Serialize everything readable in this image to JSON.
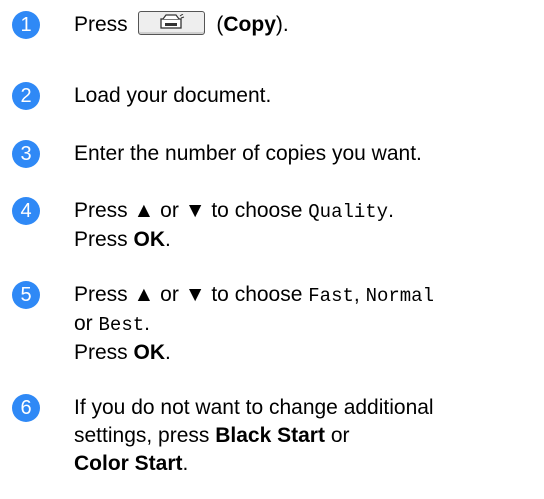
{
  "steps": [
    {
      "n": "1",
      "press": "Press",
      "open": "(",
      "bold": "Copy",
      "close": ")."
    },
    {
      "n": "2",
      "text": "Load your document."
    },
    {
      "n": "3",
      "text": "Enter the number of copies you want."
    },
    {
      "n": "4",
      "press": "Press",
      "up": "▲",
      "or": "or",
      "down": "▼",
      "to_choose": "to choose",
      "code": "Quality",
      "period": ".",
      "press2": "Press",
      "ok": "OK",
      "period2": "."
    },
    {
      "n": "5",
      "press": "Press",
      "up": "▲",
      "or": "or",
      "down": "▼",
      "to_choose": "to choose",
      "code1": "Fast",
      "comma": ",",
      "code2": "Normal",
      "or2": "or",
      "code3": "Best",
      "period": ".",
      "press2": "Press",
      "ok": "OK",
      "period2": "."
    },
    {
      "n": "6",
      "line1": "If you do not want to change additional",
      "line2_pre": "settings, press",
      "bold1": "Black Start",
      "or": "or",
      "bold2": "Color Start",
      "period": "."
    }
  ]
}
